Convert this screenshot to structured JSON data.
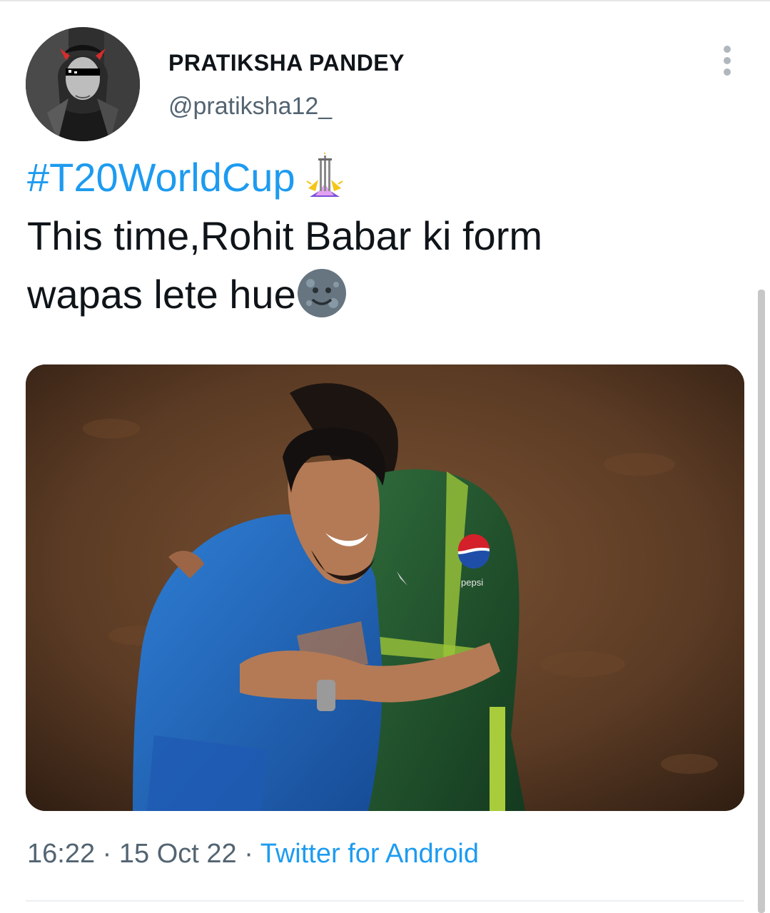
{
  "tweet": {
    "display_name": "PRATIKSHA PANDEY",
    "handle": "@pratiksha12_",
    "hashtag": "#T20WorldCup",
    "hashtag_icon": "trophy-icon",
    "text_line1": "This time,Rohit Babar ki form",
    "text_line2": "wapas lete hue",
    "text_emoji": "new-moon-face-emoji",
    "media_brand_text": "pepsi",
    "time": "16:22",
    "separator": "·",
    "date": "15 Oct 22",
    "source": "Twitter for Android"
  },
  "colors": {
    "link": "#1d9bf0",
    "text": "#0f1419",
    "muted": "#536471"
  }
}
